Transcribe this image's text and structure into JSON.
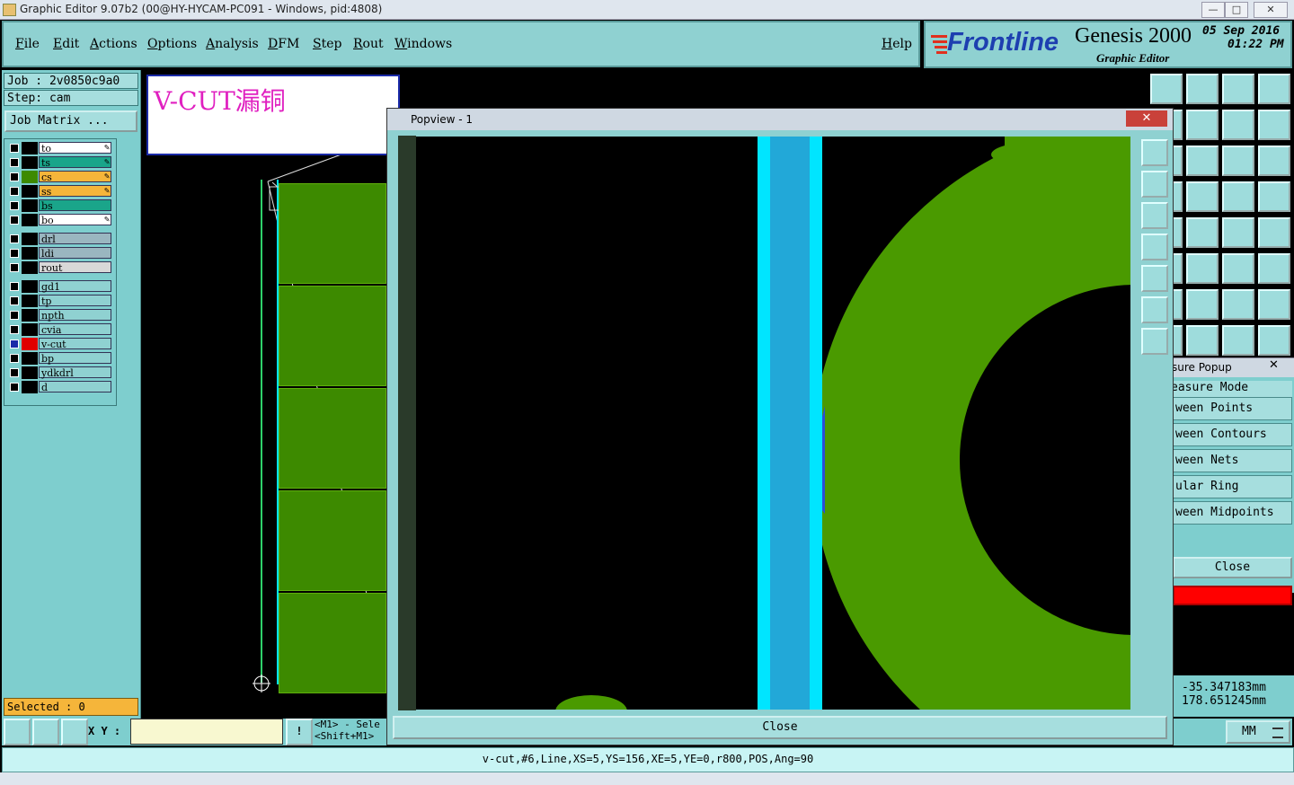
{
  "window": {
    "title": "Graphic Editor 9.07b2 (00@HY-HYCAM-PC091 - Windows, pid:4808)",
    "minimize": "—",
    "maximize": "□",
    "close": "✕"
  },
  "menu": [
    "File",
    "Edit",
    "Actions",
    "Options",
    "Analysis",
    "DFM",
    "Step",
    "Rout",
    "Windows"
  ],
  "help_label": "Help",
  "brand": {
    "logo": "Frontline",
    "product": "Genesis 2000",
    "subtitle": "Graphic Editor",
    "date": "05 Sep 2016",
    "time": "01:22 PM"
  },
  "job": {
    "job_line": "Job : 2v0850c9a0",
    "step_line": "Step: cam",
    "matrix_button": "Job Matrix ..."
  },
  "annotation": "V-CUT漏铜",
  "layers": [
    {
      "name": "to",
      "color": "#ffffff",
      "swatch": "#000000",
      "edit": true
    },
    {
      "name": "ts",
      "color": "#1aa58a",
      "swatch": "#000000",
      "edit": true
    },
    {
      "name": "cs",
      "color": "#f5b53a",
      "swatch": "#3d8a00",
      "edit": true
    },
    {
      "name": "ss",
      "color": "#f5b53a",
      "swatch": "#000000",
      "edit": true
    },
    {
      "name": "bs",
      "color": "#1aa58a",
      "swatch": "#000000",
      "edit": false
    },
    {
      "name": "bo",
      "color": "#ffffff",
      "swatch": "#000000",
      "edit": true
    },
    {
      "name": "drl",
      "color": "#9ab6c0",
      "swatch": "#000000",
      "edit": false
    },
    {
      "name": "ldi",
      "color": "#9ab6c0",
      "swatch": "#000000",
      "edit": false
    },
    {
      "name": "rout",
      "color": "#d8d8d8",
      "swatch": "#000000",
      "edit": false
    },
    {
      "name": "gd1",
      "color": "#8fd1d1",
      "swatch": "#000000",
      "edit": false
    },
    {
      "name": "tp",
      "color": "#8fd1d1",
      "swatch": "#000000",
      "edit": false
    },
    {
      "name": "npth",
      "color": "#8fd1d1",
      "swatch": "#000000",
      "edit": false
    },
    {
      "name": "cvia",
      "color": "#8fd1d1",
      "swatch": "#000000",
      "edit": false
    },
    {
      "name": "v-cut",
      "color": "#8fd1d1",
      "swatch": "#e00000",
      "edit": false,
      "affected": true
    },
    {
      "name": "bp",
      "color": "#8fd1d1",
      "swatch": "#000000",
      "edit": false
    },
    {
      "name": "ydkdrl",
      "color": "#8fd1d1",
      "swatch": "#000000",
      "edit": false
    },
    {
      "name": "d",
      "color": "#8fd1d1",
      "swatch": "#000000",
      "edit": false
    }
  ],
  "selected_label": "Selected : 0",
  "xy_label": "X Y :",
  "hint_line1": "<M1> - Sele",
  "hint_line2": "<Shift+M1>",
  "popview": {
    "title": "Popview - 1",
    "close_label": "Close"
  },
  "measure": {
    "title": "sure Popup",
    "mode_header": "easure Mode",
    "items": [
      "ween Points",
      "ween Contours",
      "ween Nets",
      "ular Ring",
      "ween Midpoints"
    ],
    "close_label": "Close"
  },
  "coords": {
    "x": "-35.347183mm",
    "y": "178.651245mm"
  },
  "units": "MM",
  "status": "v-cut,#6,Line,XS=5,YS=156,XE=5,YE=0,r800,POS,Ang=90",
  "colors": {
    "panel": "#8fd1d1",
    "copper": "#3d8a00",
    "vcut": "#00e5ff",
    "selected": "#f5b53a"
  }
}
